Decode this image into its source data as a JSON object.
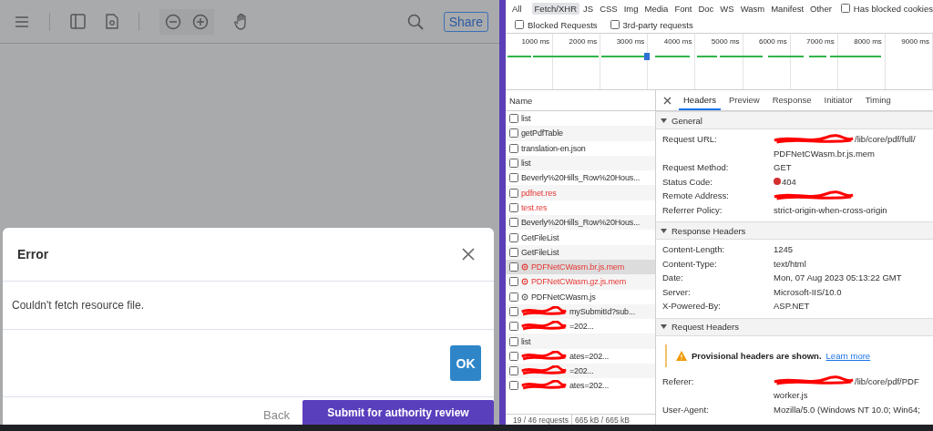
{
  "viewer": {
    "toolbar": {
      "share_button": "Share"
    },
    "dialog": {
      "title": "Error",
      "message": "Couldn't fetch resource file.",
      "ok_button": "OK"
    },
    "footer": {
      "back_button": "Back",
      "submit_button": "Submit for authority review"
    }
  },
  "devtools": {
    "filters": [
      {
        "label": "All",
        "selected": false
      },
      {
        "label": "Fetch/XHR",
        "selected": true
      },
      {
        "label": "JS",
        "selected": false
      },
      {
        "label": "CSS",
        "selected": false
      },
      {
        "label": "Img",
        "selected": false
      },
      {
        "label": "Media",
        "selected": false
      },
      {
        "label": "Font",
        "selected": false
      },
      {
        "label": "Doc",
        "selected": false
      },
      {
        "label": "WS",
        "selected": false
      },
      {
        "label": "Wasm",
        "selected": false
      },
      {
        "label": "Manifest",
        "selected": false
      },
      {
        "label": "Other",
        "selected": false
      }
    ],
    "filter_options": [
      {
        "label": "Has blocked cookies",
        "checked": false
      }
    ],
    "more_options": [
      {
        "label": "Blocked Requests",
        "checked": false
      },
      {
        "label": "3rd-party requests",
        "checked": false
      }
    ],
    "timeline_ticks": [
      "1000 ms",
      "2000 ms",
      "3000 ms",
      "4000 ms",
      "5000 ms",
      "6000 ms",
      "7000 ms",
      "8000 ms",
      "9000 ms"
    ],
    "requests": {
      "header": "Name",
      "rows": [
        {
          "name": "list",
          "kind": "plain",
          "failed": false,
          "selected": false
        },
        {
          "name": "getPdfTable",
          "kind": "plain",
          "failed": false,
          "selected": false
        },
        {
          "name": "translation-en.json",
          "kind": "plain",
          "failed": false,
          "selected": false
        },
        {
          "name": "list",
          "kind": "plain",
          "failed": false,
          "selected": false
        },
        {
          "name": "Beverly%20Hills_Row%20Hous...",
          "kind": "plain",
          "failed": false,
          "selected": false
        },
        {
          "name": "pdfnet.res",
          "kind": "plain",
          "failed": true,
          "selected": false
        },
        {
          "name": "test.res",
          "kind": "plain",
          "failed": true,
          "selected": false
        },
        {
          "name": "Beverly%20Hills_Row%20Hous...",
          "kind": "plain",
          "failed": false,
          "selected": false
        },
        {
          "name": "GetFileList",
          "kind": "plain",
          "failed": false,
          "selected": false
        },
        {
          "name": "GetFileList",
          "kind": "plain",
          "failed": false,
          "selected": false
        },
        {
          "name": "PDFNetCWasm.br.js.mem",
          "kind": "worker",
          "failed": true,
          "selected": true
        },
        {
          "name": "PDFNetCWasm.gz.js.mem",
          "kind": "worker",
          "failed": true,
          "selected": false
        },
        {
          "name": "PDFNetCWasm.js",
          "kind": "worker",
          "failed": false,
          "selected": false
        },
        {
          "name": "mySubmitId?sub...",
          "kind": "redacted",
          "failed": false,
          "selected": false
        },
        {
          "name": "=202...",
          "kind": "redacted",
          "failed": false,
          "selected": false
        },
        {
          "name": "list",
          "kind": "plain",
          "failed": false,
          "selected": false
        },
        {
          "name": "ates=202...",
          "kind": "redacted",
          "failed": false,
          "selected": false
        },
        {
          "name": "=202...",
          "kind": "redacted",
          "failed": false,
          "selected": false
        },
        {
          "name": "ates=202...",
          "kind": "redacted",
          "failed": false,
          "selected": false
        }
      ]
    },
    "status": {
      "requests": "19 / 46 requests",
      "transferred": "665 kB / 665 kB"
    },
    "details": {
      "tabs": [
        {
          "label": "Headers",
          "selected": true
        },
        {
          "label": "Preview",
          "selected": false
        },
        {
          "label": "Response",
          "selected": false
        },
        {
          "label": "Initiator",
          "selected": false
        },
        {
          "label": "Timing",
          "selected": false
        }
      ],
      "sections": [
        {
          "title": "General",
          "expanded": true,
          "rows": [
            {
              "key": "Request URL:",
              "redacted": true,
              "lines": [
                "/lib/core/pdf/full/",
                "PDFNetCWasm.br.js.mem"
              ]
            },
            {
              "key": "Request Method:",
              "redacted": false,
              "lines": [
                "GET"
              ]
            },
            {
              "key": "Status Code:",
              "redacted": false,
              "error": true,
              "lines": [
                "404"
              ]
            },
            {
              "key": "Remote Address:",
              "redacted": true
            },
            {
              "key": "Referrer Policy:",
              "redacted": false,
              "lines": [
                "strict-origin-when-cross-origin"
              ]
            }
          ]
        },
        {
          "title": "Response Headers",
          "expanded": true,
          "rows": [
            {
              "key": "Content-Length:",
              "redacted": false,
              "lines": [
                "1245"
              ]
            },
            {
              "key": "Content-Type:",
              "redacted": false,
              "lines": [
                "text/html"
              ]
            },
            {
              "key": "Date:",
              "redacted": false,
              "lines": [
                "Mon, 07 Aug 2023 05:13:22 GMT"
              ]
            },
            {
              "key": "Server:",
              "redacted": false,
              "lines": [
                "Microsoft-IIS/10.0"
              ]
            },
            {
              "key": "X-Powered-By:",
              "redacted": false,
              "lines": [
                "ASP.NET"
              ]
            }
          ]
        },
        {
          "title": "Request Headers",
          "expanded": true,
          "warning": {
            "text": "Provisional headers are shown.",
            "link": "Learn more"
          },
          "rows": [
            {
              "key": "Referer:",
              "redacted": true,
              "lines": [
                "/lib/core/pdf/PDF",
                "worker.js"
              ]
            },
            {
              "key": "User-Agent:",
              "redacted": false,
              "lines": [
                "Mozilla/5.0 (Windows NT 10.0; Win64;"
              ]
            }
          ]
        }
      ]
    }
  }
}
